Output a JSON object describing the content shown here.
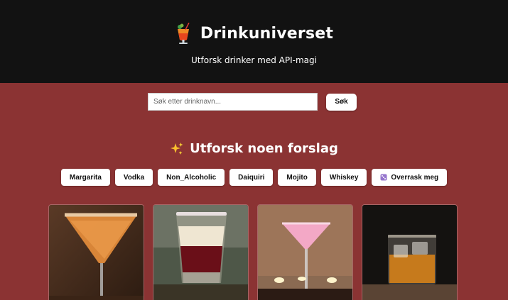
{
  "header": {
    "title": "Drinkuniverset",
    "subtitle": "Utforsk drinker med API-magi",
    "logo_icon": "tropical-drink-icon"
  },
  "search": {
    "placeholder": "Søk etter drinknavn...",
    "value": "",
    "button_label": "Søk"
  },
  "suggestions": {
    "title": "Utforsk noen forslag",
    "title_icon": "sparkles-icon",
    "chips": [
      "Margarita",
      "Vodka",
      "Non_Alcoholic",
      "Daiquiri",
      "Mojito",
      "Whiskey"
    ],
    "random_label": "Overrask meg",
    "random_icon": "dice-icon"
  },
  "drinks": [
    {
      "image": "orange-cocktail-glass"
    },
    {
      "image": "layered-shot-glass"
    },
    {
      "image": "pink-martini-glass"
    },
    {
      "image": "whiskey-rocks-glass"
    }
  ],
  "colors": {
    "background": "#8b3333",
    "header": "#121212",
    "button": "#ffffff"
  }
}
